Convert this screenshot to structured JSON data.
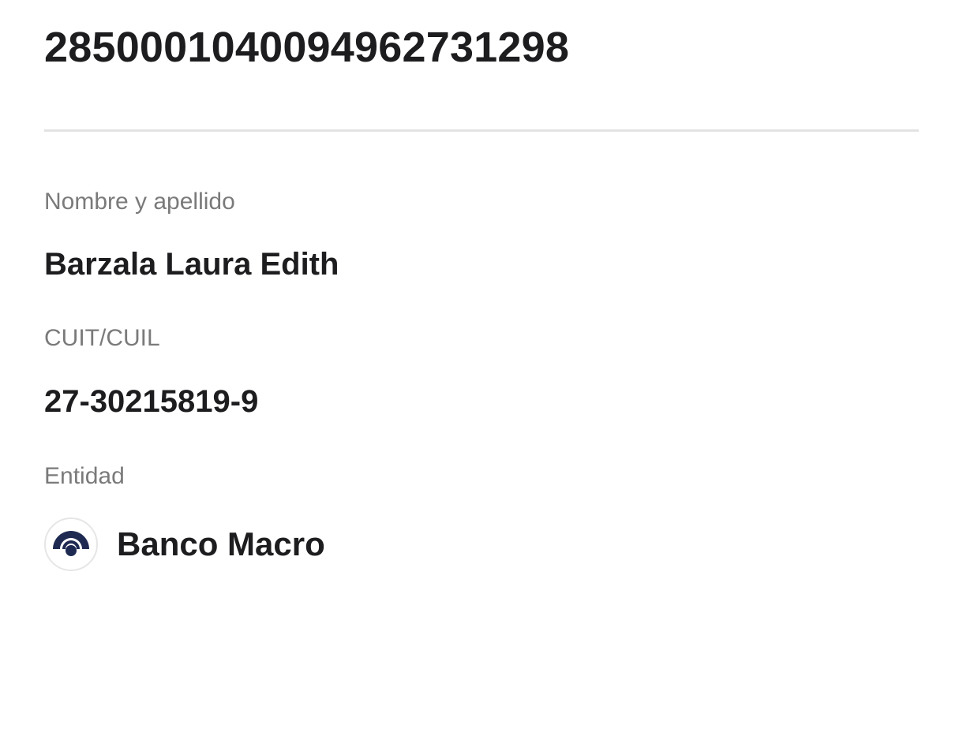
{
  "account": {
    "cbu": "2850001040094962731298"
  },
  "holder": {
    "name_label": "Nombre y apellido",
    "name_value": "Barzala Laura Edith",
    "cuit_label": "CUIT/CUIL",
    "cuit_value": "27-30215819-9"
  },
  "entity": {
    "label": "Entidad",
    "bank_name": "Banco Macro",
    "logo_icon": "banco-macro-logo-icon",
    "logo_color": "#1e2a52"
  },
  "colors": {
    "text_primary": "#1d1d1f",
    "text_secondary": "#7a7a7a",
    "divider": "#e3e3e3"
  }
}
